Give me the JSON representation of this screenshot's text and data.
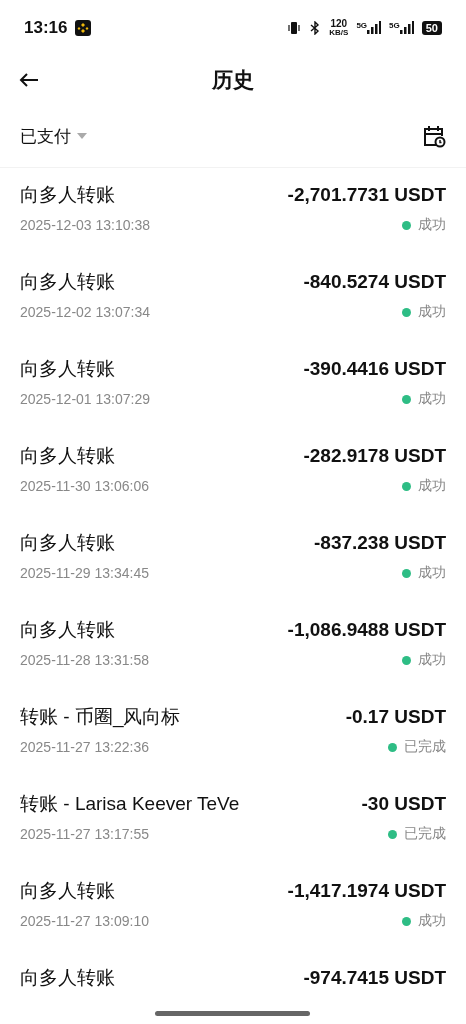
{
  "status_bar": {
    "time": "13:16",
    "speed": "120",
    "speed_unit": "KB/S",
    "net_1": "5G",
    "net_2": "5G",
    "battery": "50"
  },
  "header": {
    "title": "历史"
  },
  "filter": {
    "label": "已支付"
  },
  "transactions": [
    {
      "title": "向多人转账",
      "amount": "-2,701.7731 USDT",
      "date": "2025-12-03 13:10:38",
      "status": "成功"
    },
    {
      "title": "向多人转账",
      "amount": "-840.5274 USDT",
      "date": "2025-12-02 13:07:34",
      "status": "成功"
    },
    {
      "title": "向多人转账",
      "amount": "-390.4416 USDT",
      "date": "2025-12-01 13:07:29",
      "status": "成功"
    },
    {
      "title": "向多人转账",
      "amount": "-282.9178 USDT",
      "date": "2025-11-30 13:06:06",
      "status": "成功"
    },
    {
      "title": "向多人转账",
      "amount": "-837.238 USDT",
      "date": "2025-11-29 13:34:45",
      "status": "成功"
    },
    {
      "title": "向多人转账",
      "amount": "-1,086.9488 USDT",
      "date": "2025-11-28 13:31:58",
      "status": "成功"
    },
    {
      "title": "转账 - 币圈_风向标",
      "amount": "-0.17 USDT",
      "date": "2025-11-27 13:22:36",
      "status": "已完成"
    },
    {
      "title": "转账 - Larisa Keever TeVe",
      "amount": "-30 USDT",
      "date": "2025-11-27 13:17:55",
      "status": "已完成"
    },
    {
      "title": "向多人转账",
      "amount": "-1,417.1974 USDT",
      "date": "2025-11-27 13:09:10",
      "status": "成功"
    },
    {
      "title": "向多人转账",
      "amount": "-974.7415 USDT"
    }
  ]
}
